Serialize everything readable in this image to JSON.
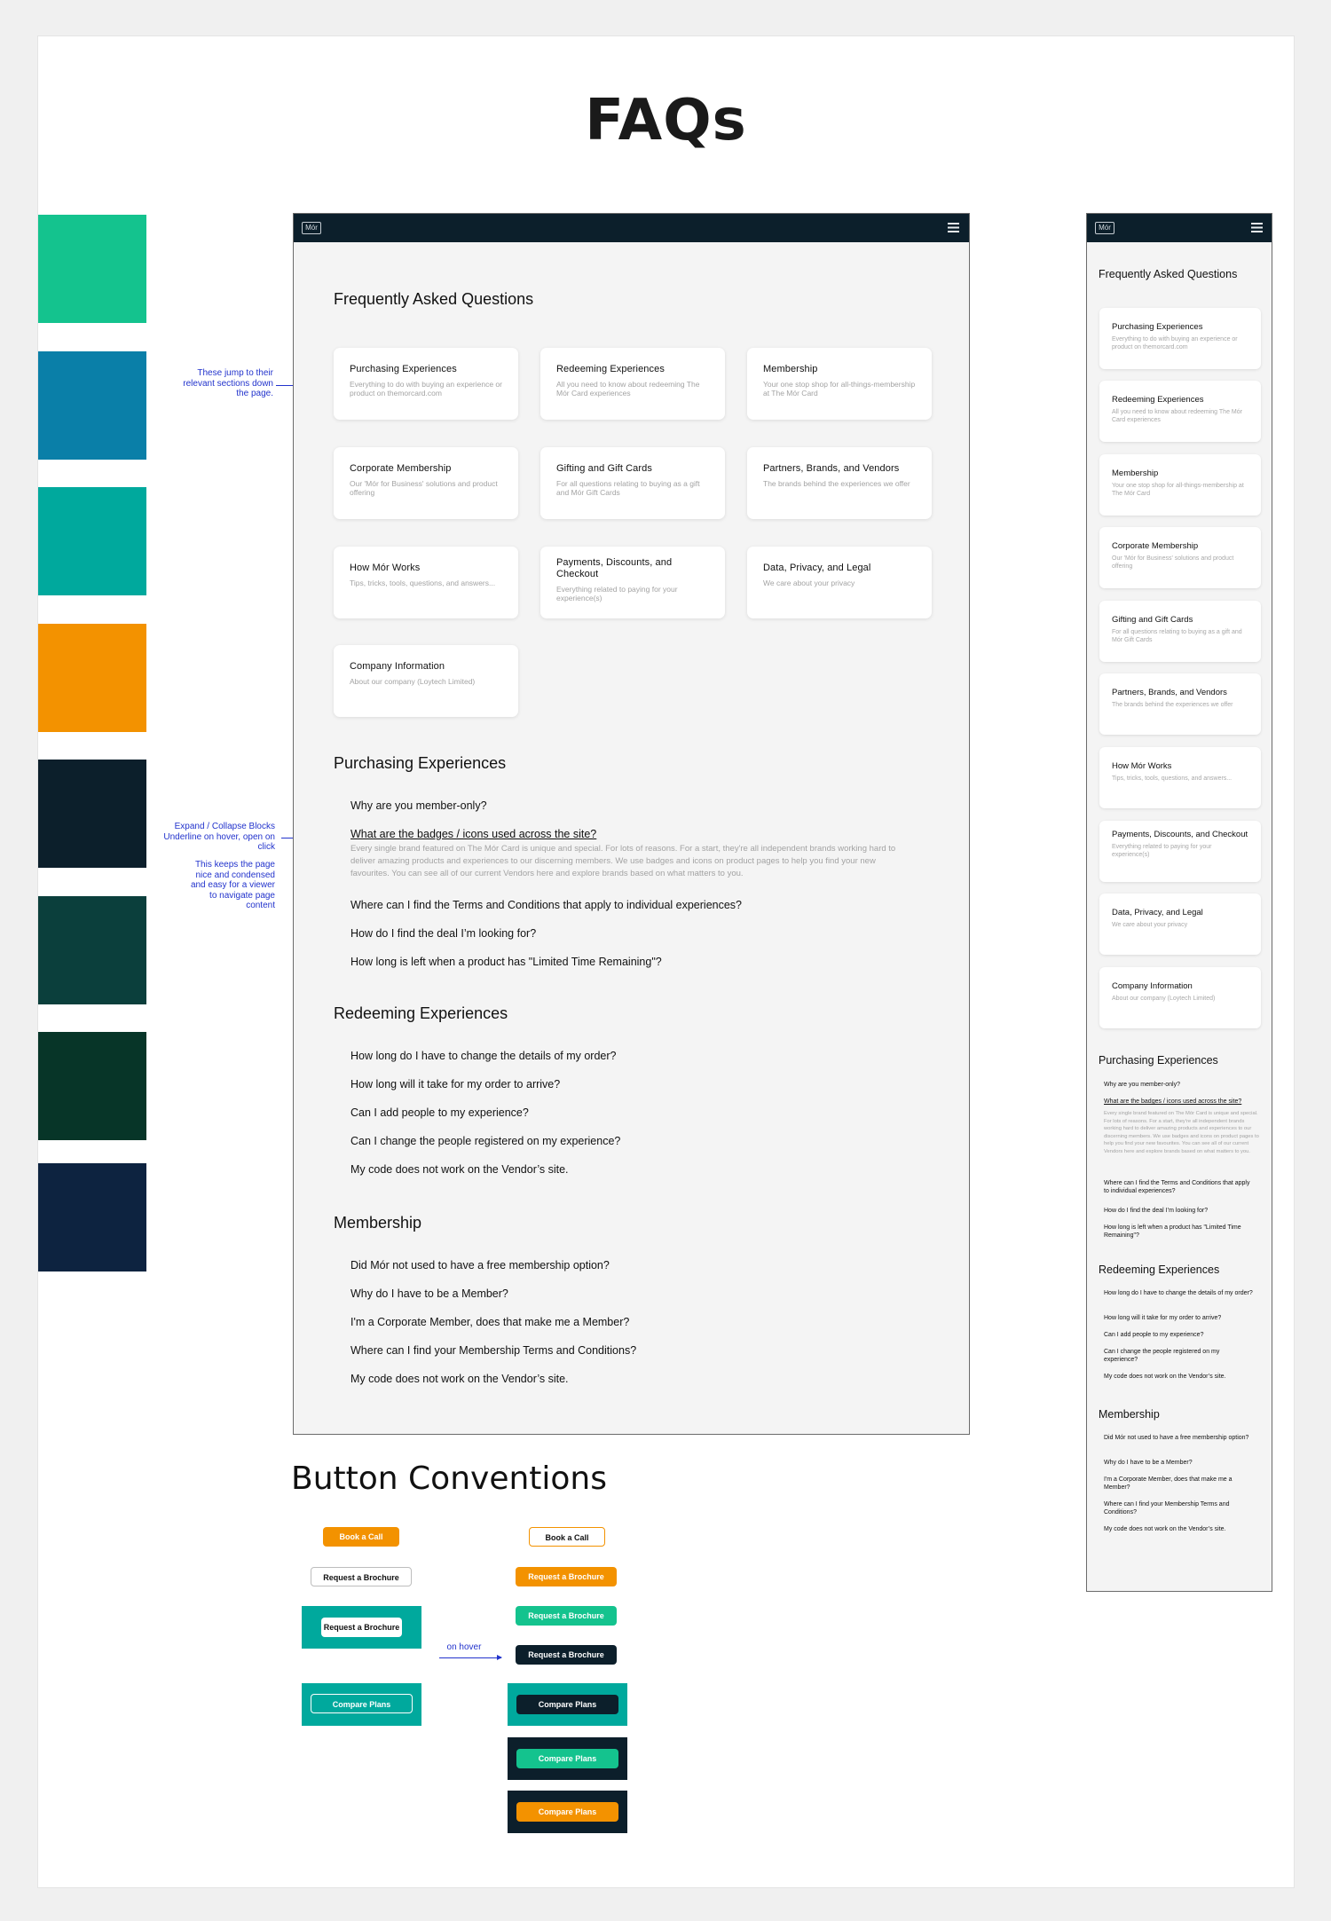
{
  "title": "FAQs",
  "swatches": [
    "#14c38e",
    "#0a7fa8",
    "#00a99d",
    "#f39200",
    "#0c1f2b",
    "#0b3f3c",
    "#073528",
    "#0d2340"
  ],
  "notes": {
    "jump": "These jump to their relevant sections down the page.",
    "expand": "Expand / Collapse Blocks Underline on hover, open on click",
    "keeps": "This keeps the page nice and condensed and easy for a viewer to navigate page content",
    "hover": "on hover"
  },
  "nav": {
    "logo": "Mór",
    "menu_icon": "hamburger-menu-icon"
  },
  "faq_heading": "Frequently Asked Questions",
  "categories": [
    {
      "title": "Purchasing Experiences",
      "desc": "Everything to do with buying an experience or product on themorcard.com"
    },
    {
      "title": "Redeeming Experiences",
      "desc": "All you need to know about redeeming The Mór Card experiences"
    },
    {
      "title": "Membership",
      "desc": "Your one stop shop for all-things-membership at The Mór Card"
    },
    {
      "title": "Corporate Membership",
      "desc": "Our 'Mór for Business' solutions and product offering"
    },
    {
      "title": "Gifting and Gift Cards",
      "desc": "For all questions relating to buying as a gift and Mór Gift Cards"
    },
    {
      "title": "Partners, Brands, and Vendors",
      "desc": "The brands behind the experiences we offer"
    },
    {
      "title": "How Mór Works",
      "desc": "Tips, tricks, tools, questions, and answers..."
    },
    {
      "title": "Payments, Discounts, and Checkout",
      "desc": "Everything related to paying for your experience(s)"
    },
    {
      "title": "Data, Privacy, and Legal",
      "desc": "We care about your privacy"
    },
    {
      "title": "Company Information",
      "desc": "About our company (Loytech Limited)"
    }
  ],
  "sections": {
    "purchasing": {
      "title": "Purchasing Experiences",
      "questions": [
        "Why are you member-only?",
        "What are the badges / icons used across the site?",
        "Where can I find the Terms and Conditions that apply to individual experiences?",
        "How do I find the deal I’m looking for?",
        "How long is left when a product has \"Limited Time Remaining\"?"
      ],
      "answer": "Every single brand featured on The Mór Card is unique and special. For lots of reasons. For a start, they're all independent brands working hard to deliver amazing products and experiences to our discerning members. We use badges and icons on product pages to help you find your new favourites. You can see all of our current Vendors here and explore brands based on what matters to you."
    },
    "redeeming": {
      "title": "Redeeming Experiences",
      "questions": [
        "How long do I have to change the details of my order?",
        "How long will it take for my order to arrive?",
        "Can I add people to my experience?",
        "Can I change the people registered on my experience?",
        "My code does not work on the Vendor’s site."
      ]
    },
    "membership": {
      "title": "Membership",
      "questions": [
        "Did Mór not used to have a free membership option?",
        "Why do I have to be a Member?",
        "I'm a Corporate Member, does that make me a Member?",
        "Where can I find your Membership Terms and Conditions?",
        "My code does not work on the Vendor’s site."
      ]
    }
  },
  "buttons": {
    "title": "Button Conventions",
    "book_call": "Book a Call",
    "request_brochure": "Request a Brochure",
    "compare_plans": "Compare Plans"
  },
  "colors": {
    "orange": "#f39200",
    "green": "#14c38e",
    "teal": "#00a99d",
    "navy": "#0c1f2b",
    "annotation": "#2233cc"
  }
}
